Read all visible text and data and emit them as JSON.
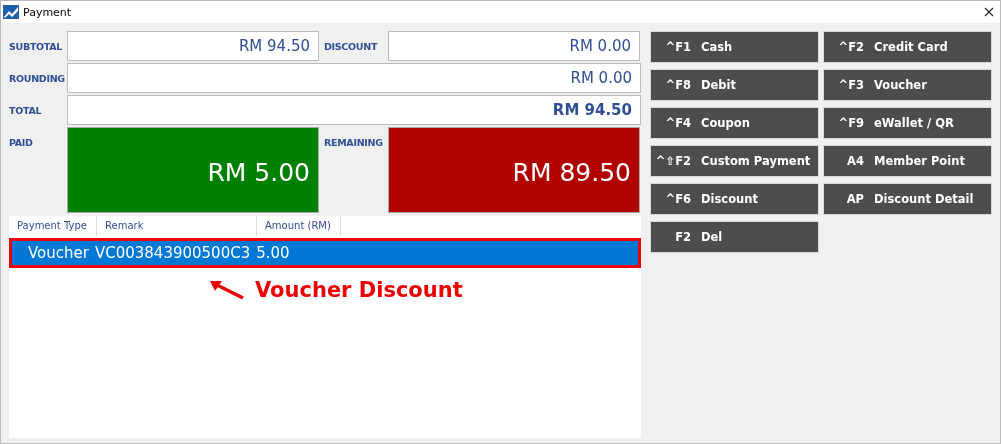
{
  "window": {
    "title": "Payment"
  },
  "summary": {
    "subtotal": {
      "label": "SUBTOTAL",
      "value": "RM 94.50"
    },
    "discount": {
      "label": "DISCOUNT",
      "value": "RM 0.00"
    },
    "rounding": {
      "label": "ROUNDING",
      "value": "RM 0.00"
    },
    "total": {
      "label": "TOTAL",
      "value": "RM 94.50"
    },
    "paid": {
      "label": "PAID",
      "value": "RM 5.00"
    },
    "remaining": {
      "label": "REMAINING",
      "value": "RM 89.50"
    }
  },
  "table": {
    "columns": [
      "Payment Type",
      "Remark",
      "Amount (RM)"
    ],
    "rows": [
      {
        "cells": [
          "Voucher",
          "VC003843900500C3",
          "5.00"
        ],
        "selected": true
      }
    ]
  },
  "annotation": {
    "text": "Voucher Discount"
  },
  "buttons": [
    {
      "key": "^F1",
      "label": "Cash"
    },
    {
      "key": "^F2",
      "label": "Credit Card"
    },
    {
      "key": "^F8",
      "label": "Debit"
    },
    {
      "key": "^F3",
      "label": "Voucher"
    },
    {
      "key": "^F4",
      "label": "Coupon"
    },
    {
      "key": "^F9",
      "label": "eWallet / QR"
    },
    {
      "key": "^⇧F2",
      "label": "Custom Payment"
    },
    {
      "key": "A4",
      "label": "Member Point"
    },
    {
      "key": "^F6",
      "label": "Discount"
    },
    {
      "key": "AP",
      "label": "Discount Detail"
    },
    {
      "key": "F2",
      "label": "Del"
    }
  ]
}
